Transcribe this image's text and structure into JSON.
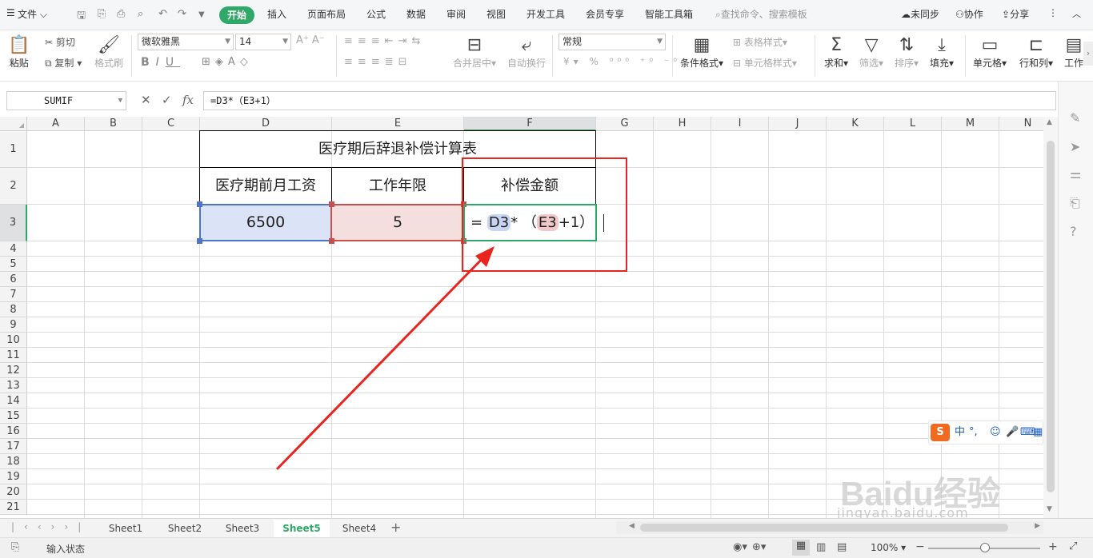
{
  "menubar": {
    "file": "文件",
    "tabs": [
      "开始",
      "插入",
      "页面布局",
      "公式",
      "数据",
      "审阅",
      "视图",
      "开发工具",
      "会员专享",
      "智能工具箱"
    ],
    "search_placeholder": "查找命令、搜索模板",
    "sync": "未同步",
    "collab": "协作",
    "share": "分享"
  },
  "ribbon": {
    "paste": "粘贴",
    "cut": "剪切",
    "copy": "复制",
    "format_painter": "格式刷",
    "font_name": "微软雅黑",
    "font_size": "14",
    "merge_center": "合并居中",
    "wrap_text": "自动换行",
    "number_format": "常规",
    "conditional_format": "条件格式",
    "table_style": "表格样式",
    "cell_style": "单元格样式",
    "sum": "求和",
    "filter": "筛选",
    "sort": "排序",
    "fill": "填充",
    "cell": "单元格",
    "row_col": "行和列",
    "worksheet": "工作"
  },
  "formula_bar": {
    "name_box": "SUMIF",
    "fx": "fx",
    "formula": "=D3*（E3+1）"
  },
  "columns": [
    "A",
    "B",
    "C",
    "D",
    "E",
    "F",
    "G",
    "H",
    "I",
    "J",
    "K",
    "L",
    "M",
    "N"
  ],
  "rows": [
    "1",
    "2",
    "3",
    "4",
    "5",
    "6",
    "7",
    "8",
    "9",
    "10",
    "11",
    "12",
    "13",
    "14",
    "15",
    "16",
    "17",
    "18",
    "19",
    "20",
    "21"
  ],
  "table": {
    "title": "医疗期后辞退补偿计算表",
    "headers": [
      "医疗期前月工资",
      "工作年限",
      "补偿金额"
    ],
    "salary": "6500",
    "years": "5",
    "formula_parts": {
      "eq": "=",
      "ref1": "D3",
      "op": "*",
      "paren_open": "（",
      "ref2": "E3",
      "plus_one": "+1）"
    }
  },
  "sheets": [
    "Sheet1",
    "Sheet2",
    "Sheet3",
    "Sheet5",
    "Sheet4"
  ],
  "active_sheet": "Sheet5",
  "status": {
    "mode": "输入状态",
    "zoom": "100%"
  },
  "ime": {
    "lang": "中",
    "punct": "°,"
  },
  "watermark": {
    "brand": "Baidu经验",
    "url": "jingyan.baidu.com"
  },
  "colors": {
    "accent": "#2fa868",
    "ref1_fill": "#dbe3f6",
    "ref2_fill": "#f4dede",
    "annotation": "#e8251f"
  }
}
